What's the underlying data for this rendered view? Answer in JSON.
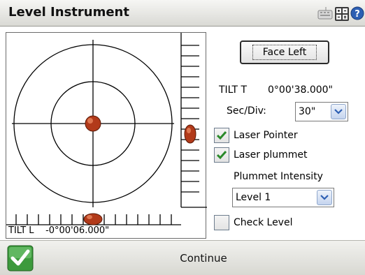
{
  "window": {
    "title": "Level Instrument"
  },
  "toolbar_icons": [
    "keyboard-icon",
    "calculator-icon",
    "help-icon"
  ],
  "viewer": {
    "tilt_l_label": "TILT L",
    "tilt_l_value": "-0°00'06.000\""
  },
  "controls": {
    "face_button_label": "Face Left",
    "tilt_t_label": "TILT T",
    "tilt_t_value": "0°00'38.000\"",
    "sec_div_label": "Sec/Div:",
    "sec_div_value": "30\"",
    "laser_pointer": {
      "label": "Laser Pointer",
      "checked": true
    },
    "laser_plummet": {
      "label": "Laser plummet",
      "checked": true
    },
    "plummet_intensity_label": "Plummet Intensity",
    "plummet_intensity_value": "Level 1",
    "check_level": {
      "label": "Check Level",
      "checked": false
    }
  },
  "footer": {
    "continue_label": "Continue"
  },
  "colors": {
    "bubble": "#b23a1a",
    "check_green": "#2a8a2a",
    "accent_blue": "#2d5fb3"
  }
}
